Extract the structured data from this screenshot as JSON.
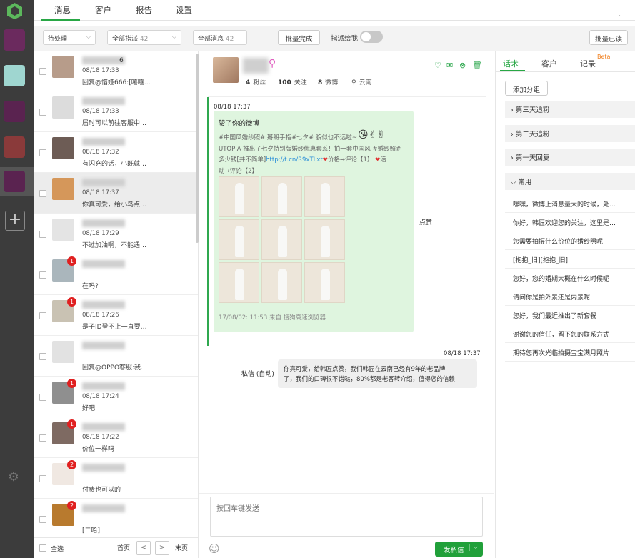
{
  "nav": {
    "tabs": [
      "消息",
      "客户",
      "报告",
      "设置"
    ],
    "caret": "ˎ"
  },
  "toolbar": {
    "status_select": "待处理",
    "assign_select": "全部指派",
    "assign_count": "42",
    "msg_select": "全部消息",
    "msg_count": "42",
    "batch_done": "批量完成",
    "assign_me_label": "指派给我",
    "batch_read": "批量已读"
  },
  "conversations": [
    {
      "name_suffix": "6",
      "time": "08/18 17:33",
      "msg": "回复@惜娅666:[嘻嘻…",
      "badge": "",
      "avatar": "#b79c8a"
    },
    {
      "name_suffix": "",
      "time": "08/18 17:33",
      "msg": "届时可以前往客服中…",
      "badge": "",
      "avatar": "#dcdcdc"
    },
    {
      "name_suffix": "",
      "time": "08/18 17:32",
      "msg": "有闪充的话，小既就…",
      "badge": "",
      "avatar": "#6d5c55"
    },
    {
      "name_suffix": "",
      "time": "08/18 17:37",
      "msg": "你真可爱，给小鸟点…",
      "badge": "",
      "avatar": "#d5975a"
    },
    {
      "name_suffix": "",
      "time": "08/18 17:29",
      "msg": "不过加油啊，不能遇…",
      "badge": "",
      "avatar": "#e4e4e4"
    },
    {
      "name_suffix": "",
      "time": "",
      "msg": "在吗?",
      "badge": "1",
      "avatar": "#aab6bc"
    },
    {
      "name_suffix": "",
      "time": "08/18 17:26",
      "msg": "是子ID登不上一直要…",
      "badge": "1",
      "avatar": "#c9c2b3"
    },
    {
      "name_suffix": "",
      "time": "",
      "msg": "回复@OPPO客服:我…",
      "badge": "",
      "avatar": "#e2e2e2"
    },
    {
      "name_suffix": "",
      "time": "08/18 17:24",
      "msg": "好吧",
      "badge": "1",
      "avatar": "#8f8f8f"
    },
    {
      "name_suffix": "",
      "time": "08/18 17:22",
      "msg": "价位一样吗",
      "badge": "1",
      "avatar": "#7e6a62"
    },
    {
      "name_suffix": "",
      "time": "",
      "msg": "付费也可以的",
      "badge": "2",
      "avatar": "#f0e8e2"
    },
    {
      "name_suffix": "",
      "time": "",
      "msg": "[二哈]",
      "badge": "2",
      "avatar": "#b87a2e"
    }
  ],
  "list_footer": {
    "select_all": "全选",
    "first": "首页",
    "prev": "<",
    "next": ">",
    "last": "末页"
  },
  "profile": {
    "gender": "♀",
    "fans": "4",
    "fans_label": "粉丝",
    "following": "100",
    "following_label": "关注",
    "weibo": "8",
    "weibo_label": "微博",
    "location": "云南"
  },
  "chat": {
    "event_time": "08/18 17:37",
    "card_title": "赞了你的微博",
    "card_text_1": "#中国风婚纱照# 掰掰手指#七夕# 貌似也不远啦~",
    "card_text_2": "UTOPIA 推出了七夕特别版婚纱优惠套系！拍一套中国风 #婚纱照#",
    "card_text_3a": "多少钱[并不简单]",
    "card_link": "http://t.cn/R9xTLxt",
    "card_text_3b": "价格→评论【1】",
    "card_text_4a": "活",
    "card_text_4b": "动→评论【2】",
    "card_footer": "17/08/02: 11:53 来自 搜狗高速浏览器",
    "event_label": "点赞",
    "reply_time": "08/18 17:37",
    "reply_sender": "私信 (自动)",
    "reply_line_1": "你真可爱，给韩匠点赞，我们韩匠在云南已经有9年的老品牌",
    "reply_line_2": "了，我们的口碑很不错哒，80%都是老客转介绍，值得您的信赖",
    "input_placeholder": "按回车键发送",
    "send_label": "发私信"
  },
  "right_panel": {
    "tabs": [
      "话术",
      "客户",
      "记录"
    ],
    "beta": "Beta",
    "add_group": "添加分组",
    "groups": [
      "第三天追粉",
      "第二天追粉",
      "第一天回复",
      "常用"
    ],
    "phrases": [
      "嘿嘿，微博上消息量大的时候，处…",
      "你好，韩匠欢迎您的关注，这里是…",
      "您需要拍摄什么价位的婚纱照呢",
      "[抱抱_旧][抱抱_旧]",
      "您好，您的婚期大概在什么时候呢",
      "请问你是拍外景还是内景呢",
      "您好，我们最近推出了新套餐",
      "谢谢您的信任，留下您的联系方式",
      "期待您再次光临拍摄宝宝满月照片"
    ]
  },
  "colors": {
    "accent": "#28a745",
    "sidebar": "#3c3c3c",
    "badge": "#e02020",
    "card": "#dff5df"
  }
}
